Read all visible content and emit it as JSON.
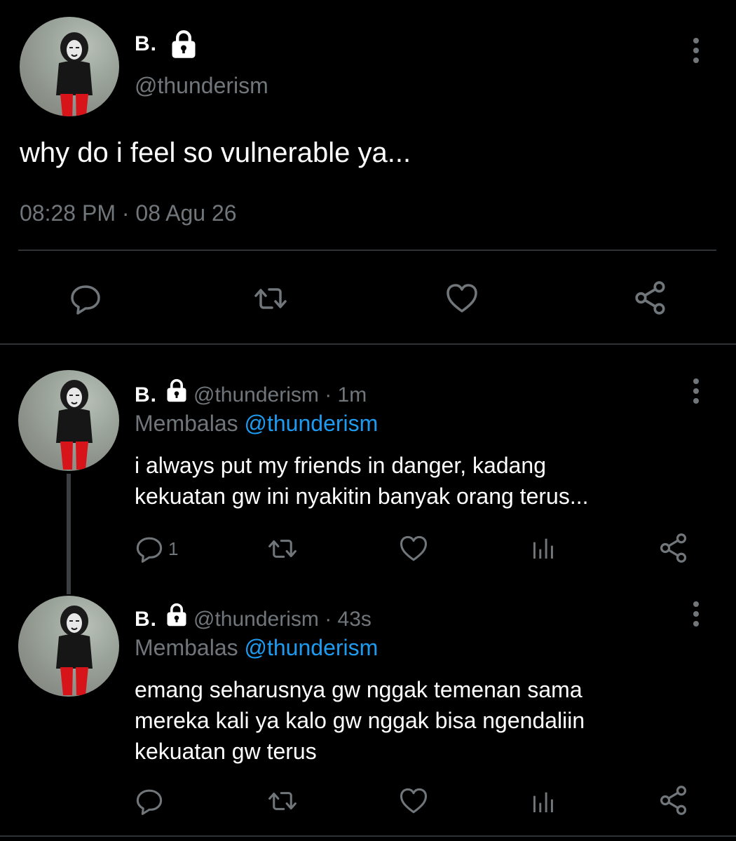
{
  "main_tweet": {
    "display_name": "B.",
    "handle": "@thunderism",
    "text": "why do i feel so vulnerable ya...",
    "timestamp": "08:28 PM · 08 Agu 26"
  },
  "replies": [
    {
      "display_name": "B.",
      "handle": "@thunderism",
      "time": "· 1m",
      "replying_label": "Membalas",
      "replying_to": "@thunderism",
      "text_lines": [
        "i always put my friends in danger, kadang",
        "kekuatan gw ini nyakitin banyak orang terus..."
      ],
      "reply_count": "1"
    },
    {
      "display_name": "B.",
      "handle": "@thunderism",
      "time": "· 43s",
      "replying_label": "Membalas",
      "replying_to": "@thunderism",
      "text_lines": [
        "emang seharusnya gw nggak temenan sama",
        "mereka kali ya kalo gw nggak bisa ngendaliin",
        "kekuatan gw terus"
      ],
      "reply_count": ""
    }
  ],
  "colors": {
    "background": "#000000",
    "text": "#ffffff",
    "muted": "#71767b",
    "link": "#1d9bf0",
    "divider": "#2f3336"
  },
  "icons": [
    "lock-icon",
    "more-icon",
    "reply-icon",
    "retweet-icon",
    "like-icon",
    "share-icon",
    "analytics-icon"
  ]
}
